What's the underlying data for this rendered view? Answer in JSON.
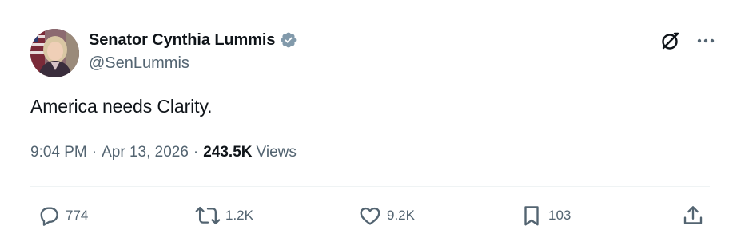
{
  "author": {
    "display_name": "Senator Cynthia Lummis",
    "handle": "@SenLummis",
    "verified_badge_color": "#829aab"
  },
  "post": {
    "text": "America needs Clarity.",
    "time": "9:04 PM",
    "date": "Apr 13, 2026",
    "separator": "·",
    "views_count": "243.5K",
    "views_label": "Views"
  },
  "actions": {
    "replies": "774",
    "reposts": "1.2K",
    "likes": "9.2K",
    "bookmarks": "103"
  },
  "icons": {
    "top_right": [
      "grok-icon",
      "more-icon"
    ],
    "action_bar": [
      "reply-icon",
      "repost-icon",
      "like-icon",
      "bookmark-icon",
      "share-icon"
    ]
  },
  "colors": {
    "text_primary": "#0f1419",
    "text_secondary": "#536471",
    "divider": "#eff3f4"
  }
}
